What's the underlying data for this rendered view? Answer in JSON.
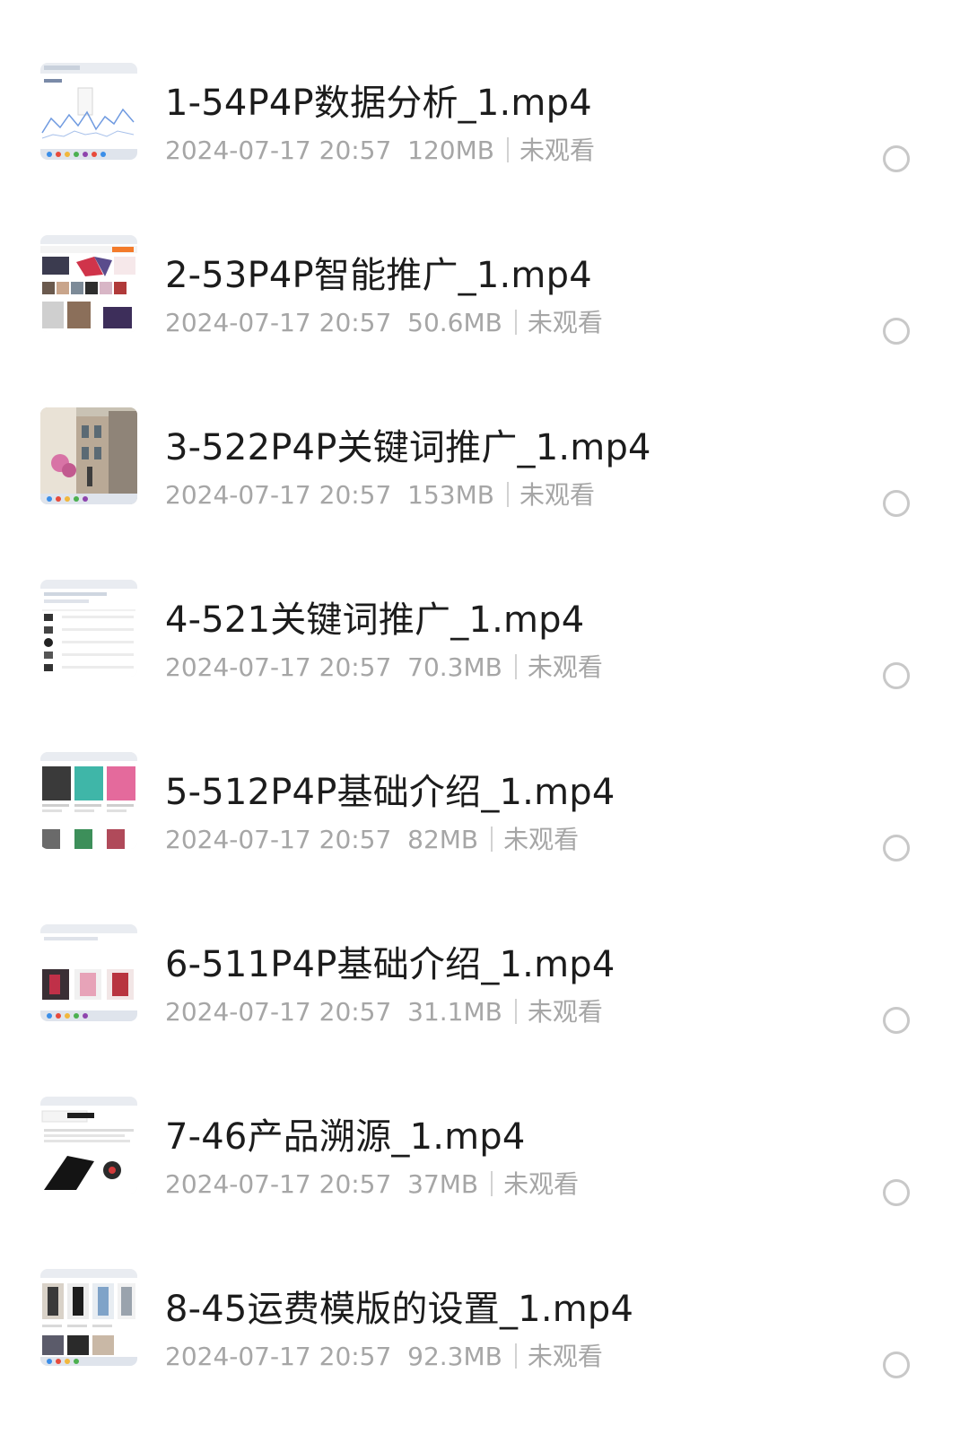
{
  "files": [
    {
      "title": "1-54P4P数据分析_1.mp4",
      "date": "2024-07-17 20:57",
      "size": "120MB",
      "status": "未观看",
      "thumb": "chart"
    },
    {
      "title": "2-53P4P智能推广_1.mp4",
      "date": "2024-07-17 20:57",
      "size": "50.6MB",
      "status": "未观看",
      "thumb": "shop"
    },
    {
      "title": "3-522P4P关键词推广_1.mp4",
      "date": "2024-07-17 20:57",
      "size": "153MB",
      "status": "未观看",
      "thumb": "photo"
    },
    {
      "title": "4-521关键词推广_1.mp4",
      "date": "2024-07-17 20:57",
      "size": "70.3MB",
      "status": "未观看",
      "thumb": "table"
    },
    {
      "title": "5-512P4P基础介绍_1.mp4",
      "date": "2024-07-17 20:57",
      "size": "82MB",
      "status": "未观看",
      "thumb": "products"
    },
    {
      "title": "6-511P4P基础介绍_1.mp4",
      "date": "2024-07-17 20:57",
      "size": "31.1MB",
      "status": "未观看",
      "thumb": "products2"
    },
    {
      "title": "7-46产品溯源_1.mp4",
      "date": "2024-07-17 20:57",
      "size": "37MB",
      "status": "未观看",
      "thumb": "phones"
    },
    {
      "title": "8-45运费模版的设置_1.mp4",
      "date": "2024-07-17 20:57",
      "size": "92.3MB",
      "status": "未观看",
      "thumb": "fashion"
    }
  ]
}
